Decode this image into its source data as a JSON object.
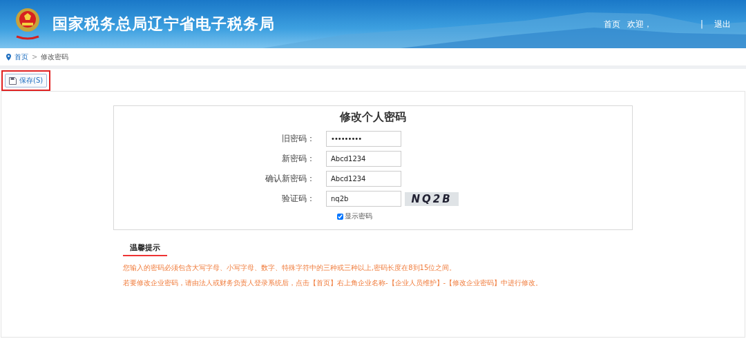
{
  "header": {
    "title": "国家税务总局辽宁省电子税务局",
    "nav": [
      {
        "kind": "link",
        "label": "首页"
      },
      {
        "kind": "text",
        "label": "欢迎，"
      },
      {
        "kind": "divider",
        "label": "|"
      },
      {
        "kind": "link",
        "label": "退出"
      }
    ]
  },
  "breadcrumb": [
    "首页",
    "修改密码"
  ],
  "breadcrumb_separator": ">",
  "toolbar": {
    "buttons": [
      {
        "label": "保存(S)",
        "highlighted": true
      }
    ]
  },
  "form": {
    "title": "修改个人密码",
    "fields": [
      {
        "kind": "password",
        "label": "旧密码：",
        "value": "•••••••••"
      },
      {
        "kind": "text",
        "label": "新密码：",
        "value": "Abcd1234"
      },
      {
        "kind": "text",
        "label": "确认新密码：",
        "value": "Abcd1234"
      },
      {
        "kind": "captcha",
        "label": "验证码：",
        "value": "nq2b",
        "captcha": "NQ2B"
      }
    ],
    "show_password": {
      "label": "显示密码",
      "checked": true
    }
  },
  "tips": {
    "title": "温馨提示",
    "lines": [
      "您输入的密码必须包含大写字母、小写字母、数字、特殊字符中的三种或三种以上,密码长度在8到15位之间。",
      "若要修改企业密码，请由法人或财务负责人登录系统后，点击【首页】右上角企业名称-【企业人员维护】-【修改企业密码】中进行修改。"
    ]
  }
}
